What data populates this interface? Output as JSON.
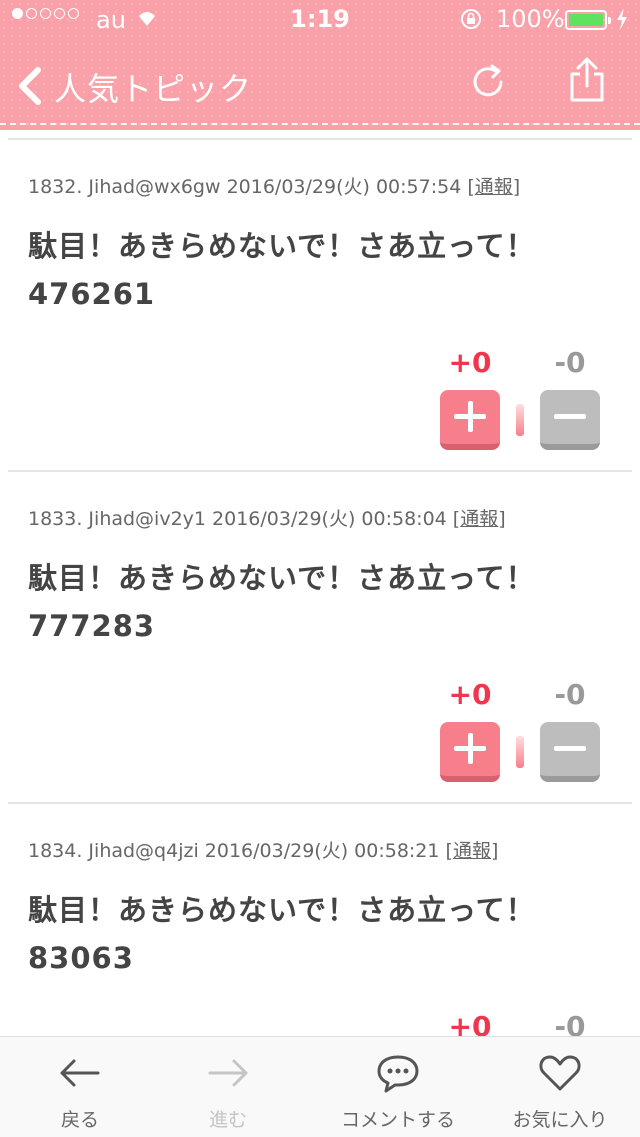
{
  "status_bar": {
    "carrier": "au",
    "time": "1:19",
    "battery": "100%",
    "battery_color": "#5de35f"
  },
  "nav": {
    "title": "人気トピック",
    "back_icon": "chevron-left-icon",
    "refresh_icon": "refresh-icon",
    "share_icon": "share-icon"
  },
  "colors": {
    "header": "#f9a0a8",
    "plus": "#f77f8c",
    "plus_score": "#f0364f",
    "minus": "#bdbdbd"
  },
  "posts": [
    {
      "meta": "1832. Jihad@wx6gw 2016/03/29(火) 00:57:54 [",
      "report": "通報",
      "meta_end": "]",
      "line1": "駄目！あきらめないで！さあ立って！",
      "line2": "476261",
      "plus_score": "+0",
      "minus_score": "-0"
    },
    {
      "meta": "1833. Jihad@iv2y1 2016/03/29(火) 00:58:04 [",
      "report": "通報",
      "meta_end": "]",
      "line1": "駄目！あきらめないで！さあ立って！",
      "line2": "777283",
      "plus_score": "+0",
      "minus_score": "-0"
    },
    {
      "meta": "1834. Jihad@q4jzi 2016/03/29(火) 00:58:21 [",
      "report": "通報",
      "meta_end": "]",
      "line1": "駄目！あきらめないで！さあ立って！",
      "line2": "83063",
      "plus_score": "+0",
      "minus_score": "-0"
    }
  ],
  "tabbar": {
    "back": "戻る",
    "forward": "進む",
    "comment": "コメントする",
    "favorite": "お気に入り"
  }
}
